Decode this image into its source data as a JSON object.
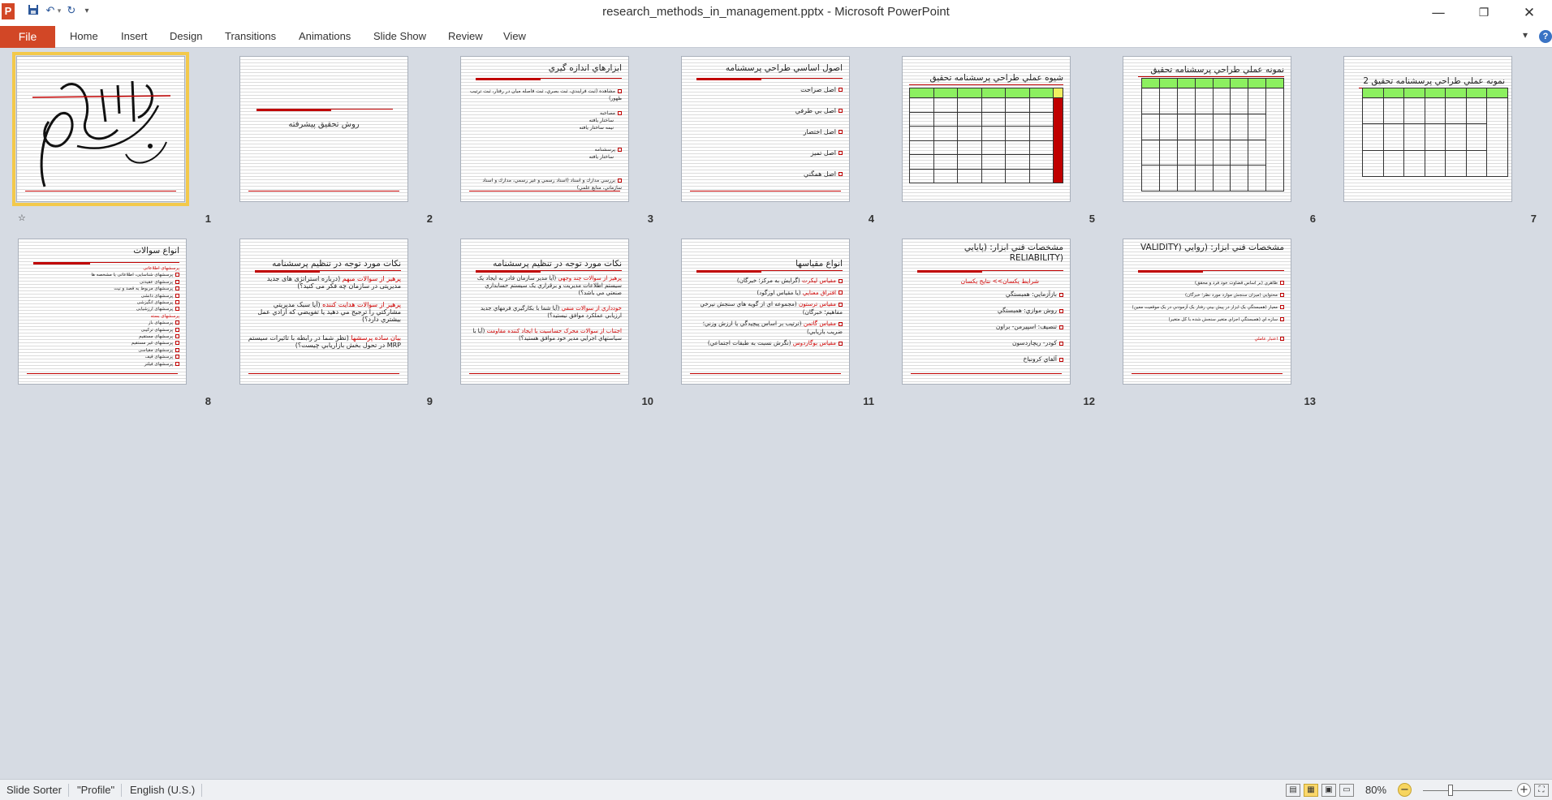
{
  "window": {
    "title": "research_methods_in_management.pptx  -  Microsoft PowerPoint",
    "app_icon_letter": "P"
  },
  "quick_access": {
    "save_icon": "save-icon",
    "undo_icon": "undo-icon",
    "redo_icon": "redo-icon",
    "customize_icon": "dropdown-icon"
  },
  "ribbon": {
    "file_label": "File",
    "tabs": [
      "Home",
      "Insert",
      "Design",
      "Transitions",
      "Animations",
      "Slide Show",
      "Review",
      "View"
    ]
  },
  "slides": [
    {
      "number": "1",
      "type": "calligraphy"
    },
    {
      "number": "2",
      "title": "روش تحقيق پيشرفته"
    },
    {
      "number": "3",
      "title": "ابزارهاي اندازه گيري",
      "lines": [
        "مشاهده (ثبت فرايندي، ثبت بصري، ثبت فاصله ميان در رفتار، ثبت ترتيب ظهور)",
        "مصاحبه",
        "ساختار يافته",
        "نيمه ساختار يافته",
        "پرسشنامه",
        "ساختار يافته",
        "بررسي مدارك و اسناد (اسناد رسمي و غير رسمي، مدارك و اسناد سازماني، منابع علمي)"
      ]
    },
    {
      "number": "4",
      "title": "اصول اساسي طراحي پرسشنامه",
      "items": [
        "اصل صراحت",
        "اصل بي طرفي",
        "اصل اختصار",
        "اصل تميز",
        "اصل همگني"
      ]
    },
    {
      "number": "5",
      "title": "شيوه عملي طراحي پرسشنامه تحقيق"
    },
    {
      "number": "6",
      "title": "نمونه عملي طراحي پرسشنامه تحقيق"
    },
    {
      "number": "7",
      "title": "نمونه عملي طراحي پرسشنامه تحقيق 2"
    },
    {
      "number": "8",
      "title": "انواع سوالات",
      "lines": [
        "پرسشهای اطلاعاتی",
        "پرسشهای شناسایی، اطلاعاتی یا مشخصه ها",
        "پرسشهای عقیدتی",
        "پرسشهای مربوط به قصد و نیت",
        "پرسشهای دانشی",
        "پرسشهای انگیزشی",
        "پرسشهای ارزشیابی",
        "پرسشهای بسته",
        "پرسشهای باز",
        "پرسشهای ترکیبی",
        "پرسشهای مستقیم",
        "پرسشهای غیر مستقیم",
        "پرسشهای مقیاسی",
        "پرسشهای قیف",
        "پرسشهای فیلتر"
      ]
    },
    {
      "number": "9",
      "title": "نکات مورد توجه در تنظيم پرسشنامه",
      "paras": [
        {
          "red": "پرهيز از سوالات مبهم",
          "rest": "(درباره استراتژی های جدید مدیریتی در سازمان چه فکر می کنید؟)"
        },
        {
          "red": "پرهيز از سوالات هدايت کننده",
          "rest": "(آيا سبک مديريتي مشارکتي را ترجيح مي دهيد يا تفويضي که آزادي عمل بيشتري دارد؟)"
        },
        {
          "red": "بيان ساده پرسشها",
          "rest": "(نظر شما در رابطه با تاثيرات سيستم MRP در تحول بخش بازاريابي چيست؟)"
        }
      ]
    },
    {
      "number": "10",
      "title": "نکات مورد توجه در تنظيم پرسشنامه",
      "paras": [
        {
          "red": "پرهيز از سوالات چند وجهي",
          "rest": "(آيا مدير سازمان قادر به ايجاد يک سيستم اطلاعات مديريت و برقراري يک سيستم حسابداري صنعتي مي باشد؟)"
        },
        {
          "red": "خودداري از سوالات منفي",
          "rest": "(آيا شما با بکارگيري فرمهاي جديد ارزيابي عملکرد موافق نيستيد؟)"
        },
        {
          "red": "اجتناب از سوالات محرک حساسيت يا ايجاد کننده مقاومت",
          "rest": "(آيا با سياستهاي اجرايي مدير خود موافق هستيد؟)"
        }
      ]
    },
    {
      "number": "11",
      "title": "انواع مقياسها",
      "items": [
        {
          "red": "مقياس ليکرت",
          "rest": "(گرايش به مرکز؛ خبرگان)"
        },
        {
          "red": "افتراق معنايي",
          "rest": "(يا مقياس اوزگود)"
        },
        {
          "red": "مقياس ترستون",
          "rest": "(مجموعه اي از گويه هاي سنجش نيرخي مفاهيم؛ خبرگان)"
        },
        {
          "red": "مقياس گاتمن",
          "rest": "(ترتيب بر اساس پيچيدگي يا ارزش وزني؛ ضريب بازيابي)"
        },
        {
          "red": "مقياس بوگاردوس",
          "rest": "(نگرش نسبت به طبقات اجتماعي)"
        }
      ]
    },
    {
      "number": "12",
      "title": "مشخصات فني ابزار: (پايايي (RELIABILITY",
      "subtitle": "شرايط يکسان>> نتايج يکسان",
      "items": [
        "بازآزمايي: همبستگي",
        "روش موازي: همبستگي",
        "تنصيف: اسپيرمن- براون",
        "کودر- ريچاردسون",
        "آلفاي کرونباخ"
      ]
    },
    {
      "number": "13",
      "title": "مشخصات فني ابزار: (روايي (VALIDITY",
      "lines": [
        "ظاهري (بر اساس قضاوت خود فرد و محقق)",
        "محتوايي (ميزان سنجش موارد مورد نظر؛ خبرگان)",
        "معيار (همبستگي يک ابزار در پيش بيني رفتار يک آزمودني در يک موقعيت معين)",
        "سازه اي (همبستگي اجزاي متغير سنجش شده با کل متغير)",
        "اعتبار عاملي"
      ]
    }
  ],
  "status": {
    "view_name": "Slide Sorter",
    "theme": "\"Profile\"",
    "language": "English (U.S.)",
    "zoom": "80%"
  }
}
